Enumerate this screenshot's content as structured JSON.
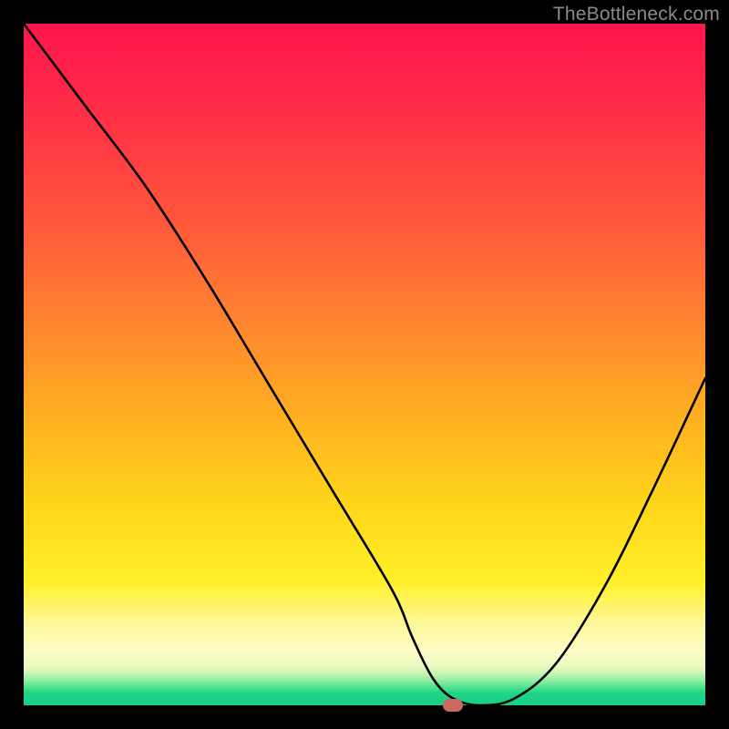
{
  "attribution": "TheBottleneck.com",
  "chart_data": {
    "type": "line",
    "title": "",
    "xlabel": "",
    "ylabel": "",
    "xlim": [
      0,
      100
    ],
    "ylim": [
      0,
      100
    ],
    "series": [
      {
        "name": "bottleneck-curve",
        "x": [
          0,
          9,
          18,
          27,
          36,
          45,
          54,
          57,
          60,
          63,
          67,
          72,
          78,
          85,
          92,
          100
        ],
        "values": [
          100,
          88,
          76,
          62,
          47,
          32,
          17,
          10,
          4,
          1,
          0,
          1,
          6,
          17,
          31,
          48
        ]
      }
    ],
    "marker": {
      "x": 63,
      "y": 0,
      "color": "#cc6a61"
    },
    "gradient_stops": [
      {
        "pos": 0,
        "color": "#ff154e"
      },
      {
        "pos": 0.3,
        "color": "#ff5a3a"
      },
      {
        "pos": 0.6,
        "color": "#ffb71f"
      },
      {
        "pos": 0.82,
        "color": "#fff02a"
      },
      {
        "pos": 0.92,
        "color": "#fdfdc7"
      },
      {
        "pos": 0.97,
        "color": "#4ce28e"
      },
      {
        "pos": 1.0,
        "color": "#18cf86"
      }
    ]
  }
}
